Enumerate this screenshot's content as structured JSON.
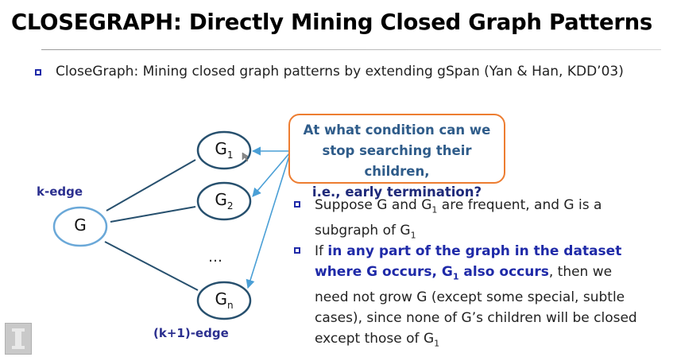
{
  "slide": {
    "title": "CLOSEGRAPH: Directly Mining Closed Graph Patterns",
    "bullet1": "CloseGraph: Mining closed graph patterns by extending gSpan (Yan & Han, KDD’03)"
  },
  "diagram": {
    "nodes": {
      "g": "G",
      "g1": "G",
      "g1_sub": "1",
      "g2": "G",
      "g2_sub": "2",
      "gn": "G",
      "gn_sub": "n"
    },
    "dots": "…",
    "k_edge_label": "k-edge",
    "k1_edge_label": "(k+1)-edge"
  },
  "callout": {
    "line1": "At what condition can we",
    "line2": "stop searching their children,",
    "line3": "i.e., early termination?"
  },
  "bullet2": {
    "p1": "Suppose G and G",
    "s1": "1",
    "p2": " are frequent, and G is a subgraph of G",
    "s2": "1"
  },
  "bullet3": {
    "p1": "If ",
    "h1": "in any part of the graph in the dataset where G occurs, G",
    "hs": "1",
    "h2": " also occurs",
    "p2": ", then we need not grow G (except some special, subtle cases), since none of G’s children will be closed except those of G",
    "s3": "1"
  },
  "colors": {
    "accent_blue": "#1f2aa8",
    "callout_border": "#ed7d31",
    "node_border": "#6aa8d8",
    "arrow": "#4a9fd6"
  }
}
